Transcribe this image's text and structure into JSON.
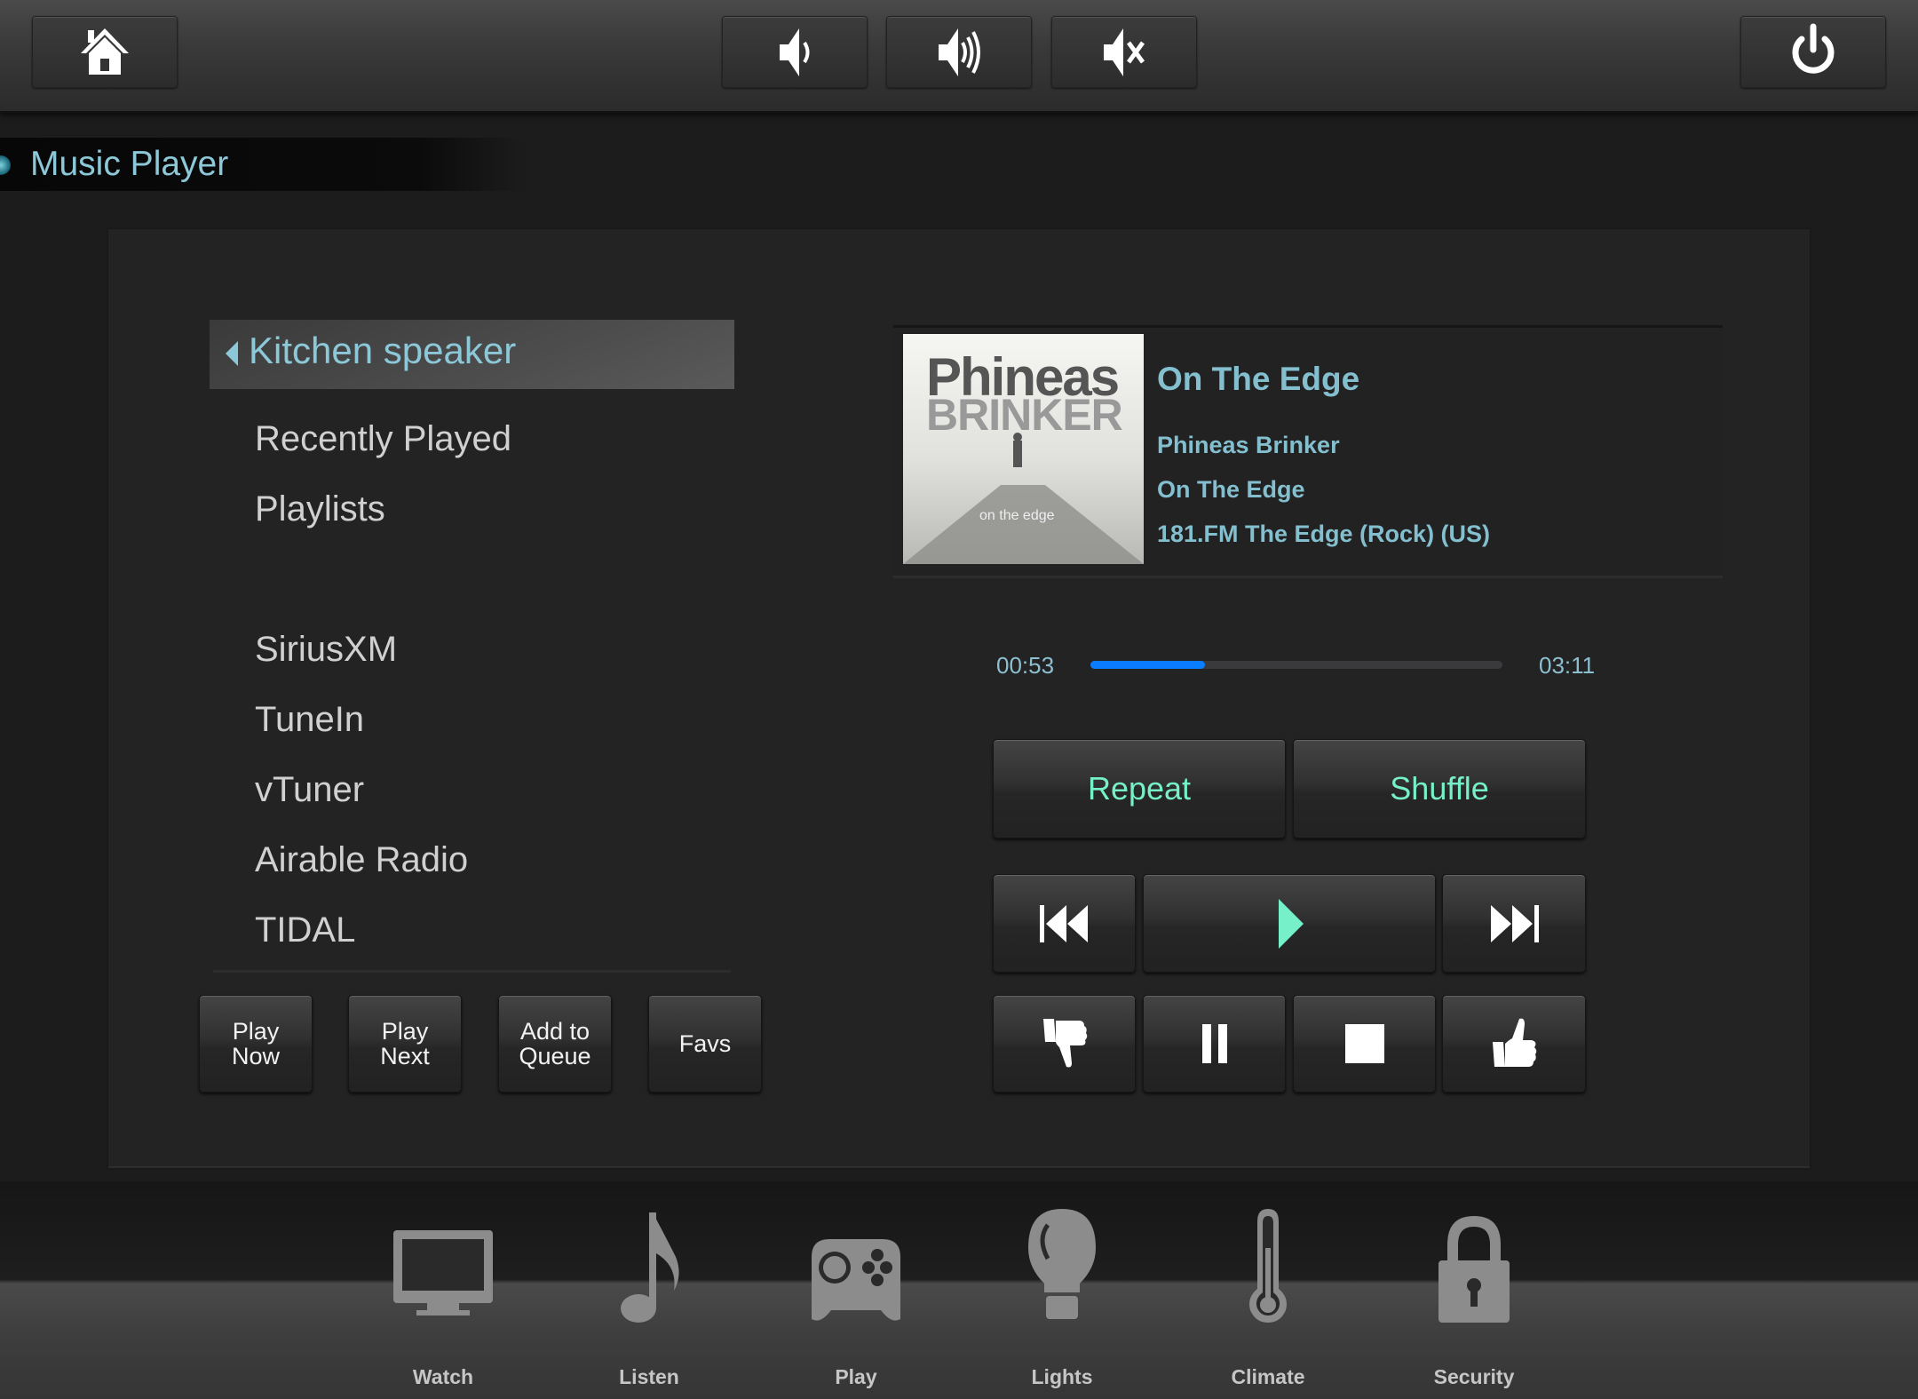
{
  "topbar": {
    "buttons": [
      {
        "name": "home-button",
        "icon": "home-icon"
      },
      {
        "name": "volume-down-button",
        "icon": "volume-down-icon"
      },
      {
        "name": "volume-up-button",
        "icon": "volume-up-icon"
      },
      {
        "name": "mute-button",
        "icon": "mute-icon"
      },
      {
        "name": "power-button",
        "icon": "power-icon"
      }
    ]
  },
  "page": {
    "title": "Music Player"
  },
  "sources": {
    "header": "Kitchen speaker",
    "items": [
      "Recently Played",
      "Playlists",
      "SiriusXM",
      "TuneIn",
      "vTuner",
      "Airable Radio",
      "TIDAL"
    ]
  },
  "actions": {
    "play_now": [
      "Play",
      "Now"
    ],
    "play_next": [
      "Play",
      "Next"
    ],
    "add_to_queue": [
      "Add to",
      "Queue"
    ],
    "favs": "Favs"
  },
  "now_playing": {
    "title": "On The Edge",
    "artist": "Phineas Brinker",
    "album": "On The Edge",
    "station": "181.FM The Edge (Rock) (US)",
    "art": {
      "line1": "Phineas",
      "line2": "BRINKER",
      "caption": "on the edge"
    }
  },
  "progress": {
    "elapsed": "00:53",
    "total": "03:11",
    "fraction": 0.277
  },
  "controls": {
    "repeat": "Repeat",
    "shuffle": "Shuffle",
    "accent_color": "#76f0c8"
  },
  "dock": {
    "items": [
      {
        "label": "Watch",
        "icon": "tv-icon"
      },
      {
        "label": "Listen",
        "icon": "music-note-icon"
      },
      {
        "label": "Play",
        "icon": "gamepad-icon"
      },
      {
        "label": "Lights",
        "icon": "lightbulb-icon"
      },
      {
        "label": "Climate",
        "icon": "thermometer-icon"
      },
      {
        "label": "Security",
        "icon": "lock-icon"
      }
    ]
  },
  "colors": {
    "title_text": "#8cc8d8",
    "progress_fill": "#0a7cff",
    "now_playing_text": "#84bfd0"
  }
}
